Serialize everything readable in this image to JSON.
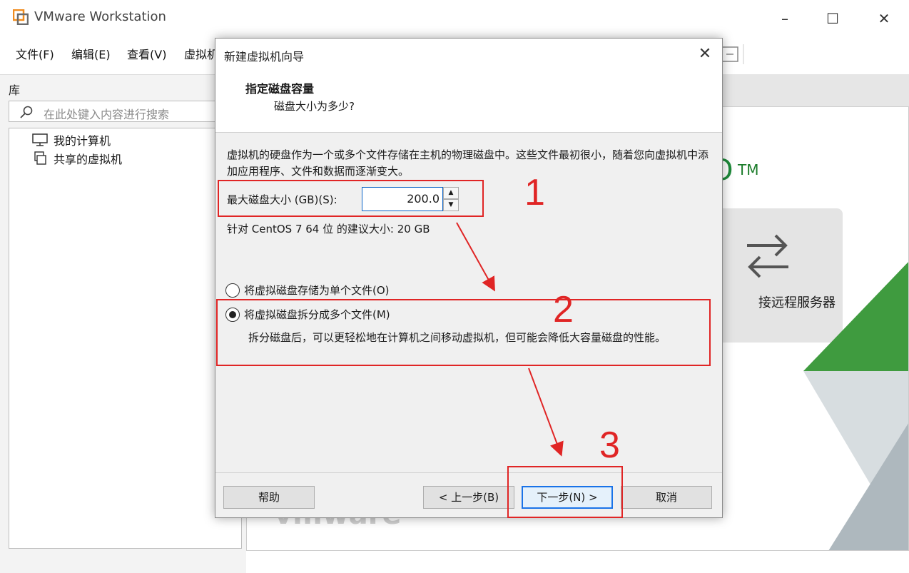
{
  "window": {
    "title": "VMware Workstation",
    "controls": {
      "minimize": "–",
      "maximize": "☐",
      "close": "✕"
    }
  },
  "menu": {
    "items": [
      "文件(F)",
      "编辑(E)",
      "查看(V)",
      "虚拟机"
    ]
  },
  "library": {
    "title": "库",
    "search_placeholder": "在此处键入内容进行搜索",
    "items": [
      {
        "label": "我的计算机",
        "icon": "monitor-icon"
      },
      {
        "label": "共享的虚拟机",
        "icon": "shared-vm-icon"
      }
    ]
  },
  "home": {
    "brand_partial": "O",
    "tm": "TM",
    "remote_label": "接远程服务器",
    "watermark": "vmware"
  },
  "dialog": {
    "title": "新建虚拟机向导",
    "heading": "指定磁盘容量",
    "subheading": "磁盘大小为多少?",
    "description": "虚拟机的硬盘作为一个或多个文件存储在主机的物理磁盘中。这些文件最初很小，随着您向虚拟机中添加应用程序、文件和数据而逐渐变大。",
    "size_label": "最大磁盘大小 (GB)(S):",
    "size_value": "200.0",
    "recommendation": "针对 CentOS 7 64 位 的建议大小: 20 GB",
    "options": [
      {
        "label": "将虚拟磁盘存储为单个文件(O)",
        "checked": false
      },
      {
        "label": "将虚拟磁盘拆分成多个文件(M)",
        "checked": true
      }
    ],
    "split_description": "拆分磁盘后，可以更轻松地在计算机之间移动虚拟机，但可能会降低大容量磁盘的性能。",
    "buttons": {
      "help": "帮助",
      "back": "< 上一步(B)",
      "next": "下一步(N) >",
      "cancel": "取消"
    }
  },
  "annotations": {
    "color": "#e02525",
    "labels": [
      "1",
      "2",
      "3"
    ]
  }
}
